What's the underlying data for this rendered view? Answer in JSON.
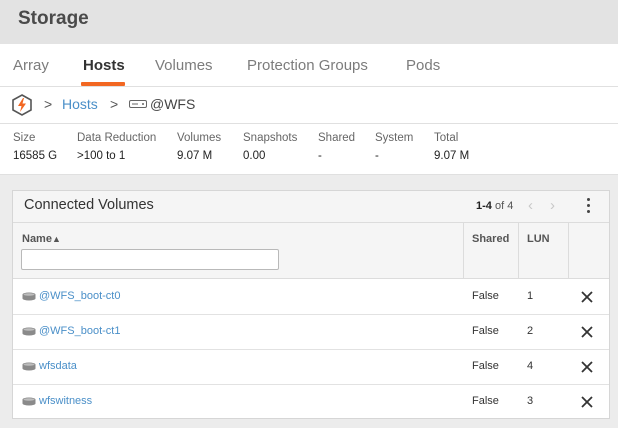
{
  "header": {
    "title": "Storage"
  },
  "tabs": [
    {
      "label": "Array"
    },
    {
      "label": "Hosts",
      "active": true
    },
    {
      "label": "Volumes"
    },
    {
      "label": "Protection Groups"
    },
    {
      "label": "Pods"
    }
  ],
  "breadcrumb": {
    "home_icon": "pure-logo-icon",
    "separator": ">",
    "link": "Hosts",
    "host_icon": "host-icon",
    "host": "@WFS"
  },
  "stats": [
    {
      "label": "Size",
      "value": "16585 G"
    },
    {
      "label": "Data Reduction",
      "value": ">100 to 1"
    },
    {
      "label": "Volumes",
      "value": "9.07 M"
    },
    {
      "label": "Snapshots",
      "value": "0.00"
    },
    {
      "label": "Shared",
      "value": "-"
    },
    {
      "label": "System",
      "value": "-"
    },
    {
      "label": "Total",
      "value": "9.07 M"
    }
  ],
  "panel": {
    "title": "Connected Volumes",
    "pager_range": "1-4",
    "pager_total": "of 4",
    "columns": {
      "name": "Name",
      "sort_glyph": "▲",
      "shared": "Shared",
      "lun": "LUN"
    },
    "filter_value": "",
    "rows": [
      {
        "name": "@WFS_boot-ct0",
        "shared": "False",
        "lun": "1"
      },
      {
        "name": "@WFS_boot-ct1",
        "shared": "False",
        "lun": "2"
      },
      {
        "name": "wfsdata",
        "shared": "False",
        "lun": "4"
      },
      {
        "name": "wfswitness",
        "shared": "False",
        "lun": "3"
      }
    ]
  },
  "colors": {
    "accent": "#f26722",
    "link": "#4a8fc8"
  }
}
